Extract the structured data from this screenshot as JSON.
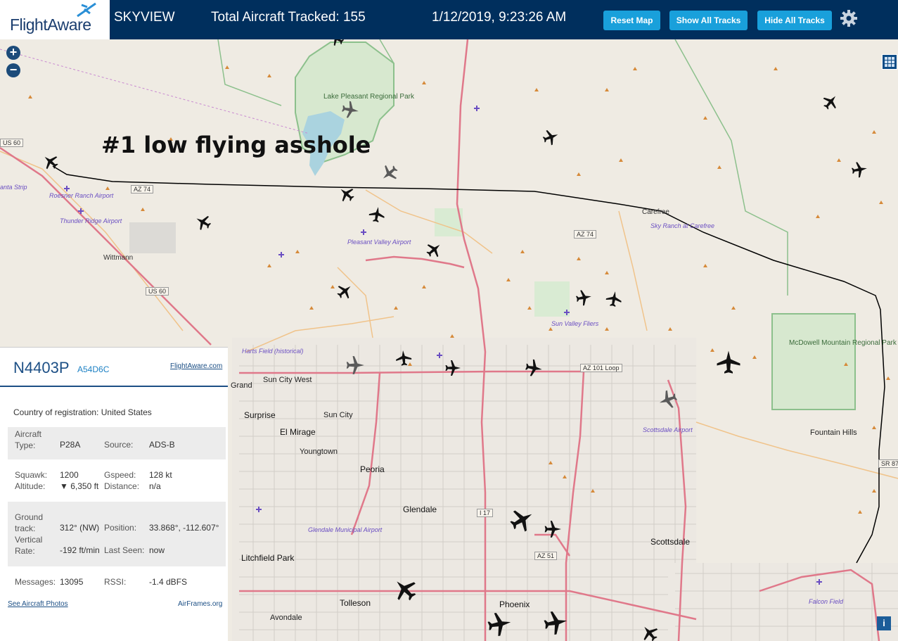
{
  "header": {
    "logo_text": "FlightAware",
    "app_name": "SKYVIEW",
    "total_label": "Total Aircraft Tracked: 155",
    "datetime": "1/12/2019, 9:23:26 AM",
    "buttons": {
      "reset": "Reset Map",
      "show_tracks": "Show All Tracks",
      "hide_tracks": "Hide All Tracks"
    },
    "settings_icon": "gear-icon"
  },
  "map": {
    "annotation": "#1 low flying asshole",
    "zoom_in": "+",
    "zoom_out": "−",
    "info": "i",
    "labels": {
      "lake_pleasant": "Lake Pleasant Regional Park",
      "carefree": "Carefree",
      "sky_ranch": "Sky Ranch at Carefree",
      "wittmann": "Wittmann",
      "roesner": "Roesner Ranch Airport",
      "thunder": "Thunder Ridge Airport",
      "santa_strip": "anta Strip",
      "pleasant_valley": "Pleasant Valley Airport",
      "sun_valley": "Sun Valley Fliers",
      "mcdowell": "McDowell Mountain Regional Park",
      "harts": "Harts Field (historical)",
      "sun_city_west": "Sun City West",
      "sun_city": "Sun City",
      "grand": "Grand",
      "surprise": "Surprise",
      "el_mirage": "El Mirage",
      "youngtown": "Youngtown",
      "peoria": "Peoria",
      "glendale": "Glendale",
      "glendale_airport": "Glendale Municipal Airport",
      "litchfield": "Litchfield Park",
      "tolleson": "Tolleson",
      "avondale": "Avondale",
      "phoenix": "Phoenix",
      "scottsdale": "Scottsdale",
      "scottsdale_airport": "Scottsdale Airport",
      "fountain_hills": "Fountain Hills",
      "falcon": "Falcon Field"
    },
    "roads": {
      "az74_w": "AZ 74",
      "az74_e": "AZ 74",
      "us60_n": "US 60",
      "us60_w": "US 60",
      "az101": "AZ 101 Loop",
      "az51": "AZ 51",
      "i17": "I 17",
      "sr87": "SR 87"
    }
  },
  "panel": {
    "registration": "N4403P",
    "hex": "A54D6C",
    "fa_link": "FlightAware.com",
    "country_label": "Country of registration:",
    "country_value": "United States",
    "aircraft_type_label": "Aircraft Type:",
    "aircraft_type_value": "P28A",
    "source_label": "Source:",
    "source_value": "ADS-B",
    "squawk_label": "Squawk:",
    "squawk_value": "1200",
    "altitude_label": "Altitude:",
    "altitude_value": "▼ 6,350 ft",
    "gspeed_label": "Gspeed:",
    "gspeed_value": "128 kt",
    "distance_label": "Distance:",
    "distance_value": "n/a",
    "ground_track_label": "Ground track:",
    "ground_track_value": "312° (NW)",
    "vertical_rate_label": "Vertical Rate:",
    "vertical_rate_value": "-192 ft/min",
    "position_label": "Position:",
    "position_value": "33.868°, -112.607°",
    "last_seen_label": "Last Seen:",
    "last_seen_value": "now",
    "messages_label": "Messages:",
    "messages_value": "13095",
    "rssi_label": "RSSI:",
    "rssi_value": "-1.4 dBFS",
    "photos_link": "See Aircraft Photos",
    "airframes_link": "AirFrames.org"
  },
  "colors": {
    "header_bg": "#002f5d",
    "button": "#19a0db",
    "track_line": "#000000",
    "highway": "#e0788a",
    "park_border": "#8cc08c"
  }
}
